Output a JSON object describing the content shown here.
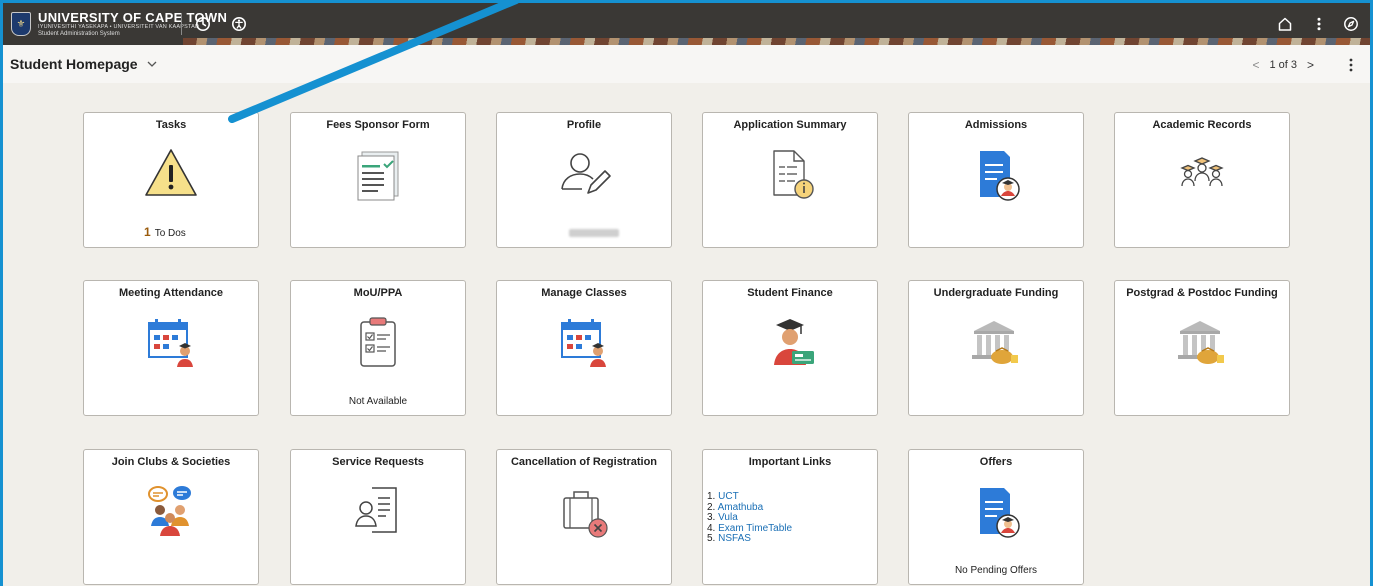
{
  "header": {
    "university": "UNIVERSITY OF CAPE TOWN",
    "university_sub": "IYUNIVESITHI YASEKAPA • UNIVERSITEIT VAN KAAPSTAD",
    "system_name": "Student Administration System",
    "icons": [
      "clock-icon",
      "accessibility-icon",
      "home-icon",
      "more-vertical-icon",
      "compass-icon"
    ]
  },
  "subheader": {
    "title": "Student Homepage",
    "pager": "1 of 3"
  },
  "tiles": [
    {
      "title": "Tasks",
      "icon": "warning-icon",
      "count": "1",
      "count_label": "To Dos"
    },
    {
      "title": "Fees Sponsor Form",
      "icon": "form-checklist-icon"
    },
    {
      "title": "Profile",
      "icon": "user-edit-icon"
    },
    {
      "title": "Application Summary",
      "icon": "document-info-icon"
    },
    {
      "title": "Admissions",
      "icon": "document-graduate-icon"
    },
    {
      "title": "Academic Records",
      "icon": "graduates-icon"
    },
    {
      "title": "Meeting Attendance",
      "icon": "calendar-person-icon"
    },
    {
      "title": "MoU/PPA",
      "icon": "clipboard-checklist-icon",
      "footer": "Not Available"
    },
    {
      "title": "Manage Classes",
      "icon": "calendar-person-icon"
    },
    {
      "title": "Student Finance",
      "icon": "graduate-money-icon"
    },
    {
      "title": "Undergraduate Funding",
      "icon": "bank-money-icon"
    },
    {
      "title": "Postgrad & Postdoc Funding",
      "icon": "bank-money-icon"
    },
    {
      "title": "Join Clubs & Societies",
      "icon": "people-chat-icon"
    },
    {
      "title": "Service Requests",
      "icon": "user-document-icon"
    },
    {
      "title": "Cancellation of Registration",
      "icon": "briefcase-cancel-icon"
    },
    {
      "title": "Important Links",
      "links": [
        "UCT",
        "Amathuba",
        "Vula",
        "Exam TimeTable",
        "NSFAS"
      ]
    },
    {
      "title": "Offers",
      "icon": "document-graduate-icon",
      "footer": "No Pending Offers"
    }
  ],
  "colors": {
    "frame_border": "#1591d1",
    "topbar": "#3a3835",
    "link": "#1a6fb5",
    "accent_orange": "#e0922e",
    "accent_blue": "#2d7bd8",
    "accent_red": "#d9463c",
    "accent_green": "#3aa57a"
  }
}
